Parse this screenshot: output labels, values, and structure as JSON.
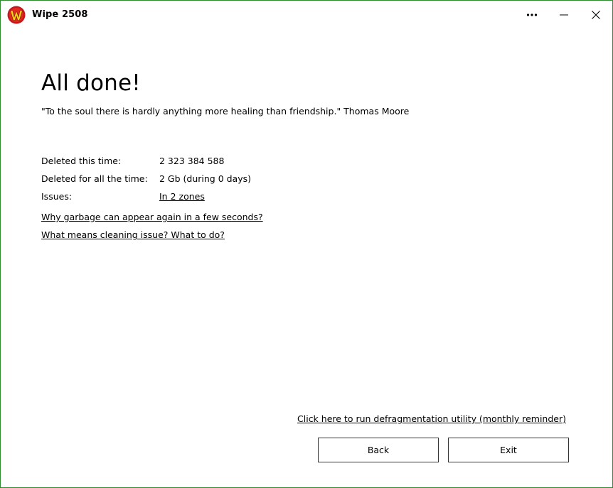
{
  "window": {
    "title": "Wipe 2508",
    "border_color": "#2e8b2e",
    "icons": {
      "logo": "wipe-logo-icon",
      "more": "more-options-icon",
      "minimize": "minimize-icon",
      "close": "close-icon"
    }
  },
  "main": {
    "heading": "All done!",
    "quote": "\"To the soul there is hardly anything more healing than friendship.\" Thomas Moore",
    "stats": [
      {
        "label": "Deleted this time:",
        "value": "2 323 384 588"
      },
      {
        "label": "Deleted for all the time:",
        "value": "2 Gb (during 0 days)"
      },
      {
        "label": "Issues:",
        "value": "In 2 zones"
      }
    ],
    "help_links": [
      "Why garbage can appear again in a few seconds?",
      "What means cleaning issue? What to do?"
    ]
  },
  "footer": {
    "defrag_link": "Click here to run defragmentation utility (monthly reminder)",
    "back_label": "Back",
    "exit_label": "Exit"
  }
}
